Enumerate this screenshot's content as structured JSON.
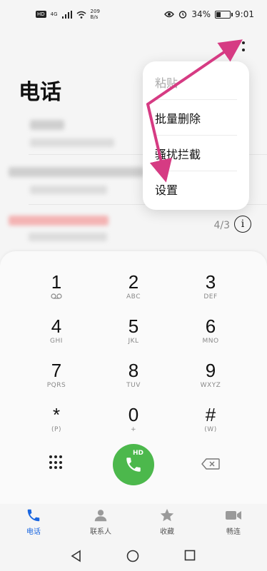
{
  "status_bar": {
    "hd": "HD",
    "signal": "4G",
    "net_speed_value": "209",
    "net_speed_unit": "B/s",
    "battery": "34%",
    "battery_level": 0.34,
    "time": "9:01"
  },
  "header": {
    "title": "电话"
  },
  "recent_calls": {
    "row3_meta": "4/3"
  },
  "menu": {
    "items": [
      {
        "label": "粘贴",
        "enabled": false
      },
      {
        "label": "批量删除",
        "enabled": true
      },
      {
        "label": "骚扰拦截",
        "enabled": true
      },
      {
        "label": "设置",
        "enabled": true
      }
    ]
  },
  "dialpad": {
    "keys": [
      {
        "digit": "1",
        "letters": ""
      },
      {
        "digit": "2",
        "letters": "ABC"
      },
      {
        "digit": "3",
        "letters": "DEF"
      },
      {
        "digit": "4",
        "letters": "GHI"
      },
      {
        "digit": "5",
        "letters": "JKL"
      },
      {
        "digit": "6",
        "letters": "MNO"
      },
      {
        "digit": "7",
        "letters": "PQRS"
      },
      {
        "digit": "8",
        "letters": "TUV"
      },
      {
        "digit": "9",
        "letters": "WXYZ"
      },
      {
        "digit": "*",
        "letters": "(P)"
      },
      {
        "digit": "0",
        "letters": "+"
      },
      {
        "digit": "#",
        "letters": "(W)"
      }
    ],
    "call_hd": "HD"
  },
  "bottom_nav": {
    "items": [
      {
        "label": "电话",
        "icon": "phone-icon",
        "active": true
      },
      {
        "label": "联系人",
        "icon": "person-icon",
        "active": false
      },
      {
        "label": "收藏",
        "icon": "star-icon",
        "active": false
      },
      {
        "label": "畅连",
        "icon": "video-icon",
        "active": false
      }
    ]
  },
  "colors": {
    "accent": "#1a66e0",
    "call_green": "#4cb84c",
    "annotation_arrow": "#d63b83"
  }
}
